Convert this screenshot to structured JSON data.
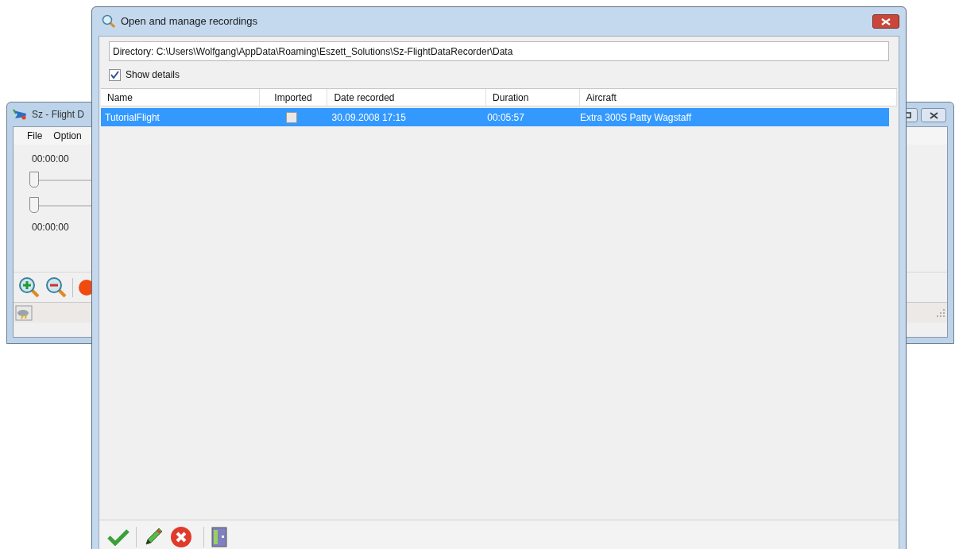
{
  "background_window": {
    "title": "Sz - Flight D",
    "menu": [
      "File",
      "Option"
    ],
    "controls": [
      {
        "kind": "time",
        "text": "00:00:00"
      },
      {
        "kind": "slider",
        "level": 0
      },
      {
        "kind": "slider",
        "level": 0
      },
      {
        "kind": "time",
        "text": "00:00:00"
      }
    ]
  },
  "dialog": {
    "title": "Open and manage recordings",
    "directory": "Directory: C:\\Users\\Wolfgang\\AppData\\Roaming\\Eszett_Solutions\\Sz-FlightDataRecorder\\Data",
    "show_details": {
      "label": "Show details",
      "checked": true
    },
    "table": {
      "columns": [
        "Name",
        "Imported",
        "Date recorded",
        "Duration",
        "Aircraft"
      ],
      "rows": [
        {
          "name": "TutorialFlight",
          "imported": false,
          "date_recorded": "30.09.2008 17:15",
          "duration": "00:05:57",
          "aircraft": "Extra 300S Patty Wagstaff",
          "selected": true
        }
      ]
    }
  }
}
